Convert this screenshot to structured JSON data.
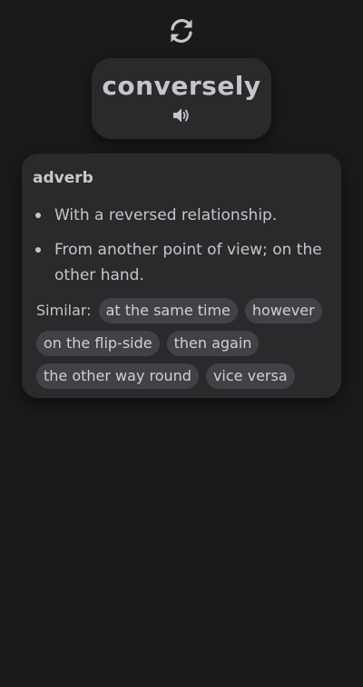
{
  "header": {
    "refresh_icon": "refresh-icon"
  },
  "word_card": {
    "word": "conversely",
    "speaker_icon": "speaker-icon"
  },
  "definition": {
    "part_of_speech": "adverb",
    "senses": [
      "With a reversed relationship.",
      "From another point of view; on the other hand."
    ],
    "similar_label": "Similar:",
    "similar": [
      "at the same time",
      "however",
      "on the flip-side",
      "then again",
      "the other way round",
      "vice versa"
    ]
  },
  "colors": {
    "background": "#1a1a1b",
    "card": "#2a2a2c",
    "chip": "#424246",
    "text": "#c6c6ca"
  }
}
